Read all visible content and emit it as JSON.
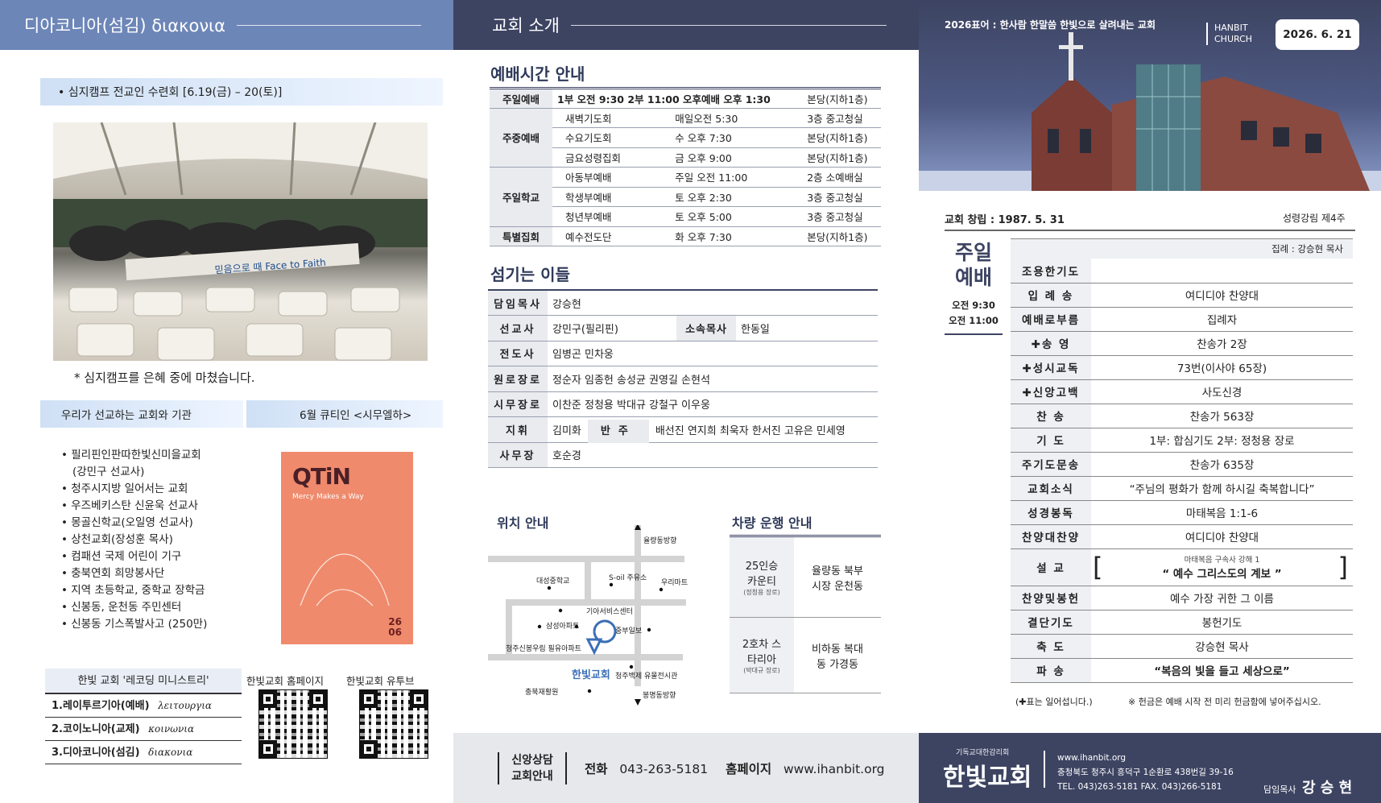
{
  "col1": {
    "header": "디아코니아(섬김) διακονια",
    "notice": "• 심지캠프 전교인 수련회 [6.19(금) – 20(토)]",
    "photo_banner": "믿음으로 때 Face to Faith",
    "photo_caption": "* 심지캠프를 은혜 중에 마쳤습니다.",
    "mission_title": "우리가 선교하는 교회와 기관",
    "qtin_title": "6월 큐티인 <시무엘하>",
    "mission_items": [
      "필리핀인판따한빛신미을교회",
      "(강민구 선교사)",
      "청주시지방 일어서는 교회",
      "우즈베키스탄 신윤욱 선교사",
      "몽골신학교(오일영 선교사)",
      "상천교회(장성훈 목사)",
      "컴패션 국제 어린이 기구",
      "충북연회 희망봉사단",
      "지역 초등학교, 중학교 장학금",
      "신봉동, 운천동 주민센터",
      "신봉동 기스폭발사고 (250만)"
    ],
    "book": {
      "logo": "QTiN",
      "subtitle": "Mercy Makes a Way",
      "issue_year": "26",
      "issue_month": "06"
    },
    "recording_title": "한빛 교회 '레코딩 미니스트리'",
    "recording_items": [
      {
        "label": "1.레이투르기아(예배)",
        "greek": "λειτουργια"
      },
      {
        "label": "2.코이노니아(교제)",
        "greek": "κοινωνια"
      },
      {
        "label": "3.디아코니아(섬김)",
        "greek": "διακονια"
      }
    ],
    "homepage_label": "한빛교회 홈페이지",
    "youtube_label": "한빛교회 유투브"
  },
  "col2": {
    "header": "교회 소개",
    "worship_title": "예배시간 안내",
    "worship_rows": [
      {
        "cat": "주일예배",
        "name": "1부 오전 9:30  2부 11:00  오후예배 오후 1:30",
        "time": "",
        "place": "본당(지하1층)"
      },
      {
        "cat": "주중예배",
        "name": "새벽기도회",
        "time": "매일오전 5:30",
        "place": "3층 중고청실"
      },
      {
        "cat": "",
        "name": "수요기도회",
        "time": "수 오후 7:30",
        "place": "본당(지하1층)"
      },
      {
        "cat": "",
        "name": "금요성령집회",
        "time": "금 오후 9:00",
        "place": "본당(지하1층)"
      },
      {
        "cat": "주일학교",
        "name": "아동부예배",
        "time": "주일 오전 11:00",
        "place": "2층 소예배실"
      },
      {
        "cat": "",
        "name": "학생부예배",
        "time": "토 오후 2:30",
        "place": "3층 중고청실"
      },
      {
        "cat": "",
        "name": "청년부예배",
        "time": "토 오후 5:00",
        "place": "3층 중고청실"
      },
      {
        "cat": "특별집회",
        "name": "예수전도단",
        "time": "화 오후 7:30",
        "place": "본당(지하1층)"
      }
    ],
    "staff_title": "섬기는 이들",
    "staff": {
      "pastor_k": "담임목사",
      "pastor_v": "강승현",
      "missionary_k": "선교사",
      "missionary_v": "강민구(필리핀)",
      "assoc_k": "소속목사",
      "assoc_v": "한동일",
      "evangelist_k": "전도사",
      "evangelist_v": "임병곤 민차웅",
      "elder_emer_k": "원로장로",
      "elder_emer_v": "정순자 임종헌 송성균 권영길 손현석",
      "elder_k": "시무장로",
      "elder_v": "이찬준 정청용 박대규 강철구 이우웅",
      "conductor_k": "지휘",
      "conductor_v": "김미화",
      "accomp_k": "반주",
      "accomp_v": "배선진 연지희 최욱자 한서진 고유은 민세영",
      "office_k": "사무장",
      "office_v": "호순경"
    },
    "location_title": "위치 안내",
    "map_labels": {
      "n1": "율량동방향",
      "n2": "대성중학교",
      "n3": "S-oil 주유소",
      "n4": "우리마트",
      "n5": "기아서비스센터",
      "n6": "삼성아파트",
      "n7": "중부일보",
      "n8": "청주신봉우림 필유아파트",
      "n9": "한빛교회",
      "n10": "청주백제 유물전시관",
      "n11": "충북재활원",
      "n12": "봉명동방향"
    },
    "bus_title": "차량 운행 안내",
    "bus": [
      {
        "car": "25인승 카운티",
        "driver": "(정청용 장로)",
        "route": "율량동 북부시장 운천동"
      },
      {
        "car": "2호차 스타리아",
        "driver": "(박대규 장로)",
        "route": "비하동 복대동 가경동"
      }
    ],
    "footer": {
      "label": "신앙상담 교회안내",
      "tel_k": "전화",
      "tel_v": "043-263-5181",
      "web_k": "홈페이지",
      "web_v": "www.ihanbit.org"
    }
  },
  "col3": {
    "slogan": "2026표어 : 한사람 한말씀 한빛으로 살려내는 교회",
    "church_en": "HANBIT CHURCH",
    "date": "2026. 6. 21",
    "founded": "교회 창립 : 1987. 5. 31",
    "season": "성령강림 제4주",
    "worship_label": "주일 예배",
    "worship_times": [
      "오전 9:30",
      "오전 11:00"
    ],
    "leader": "집례 : 강승현 목사",
    "order": [
      {
        "k": "조용한기도",
        "v": ""
      },
      {
        "k": "입 례 송",
        "v": "여디디야 찬양대"
      },
      {
        "k": "예배로부름",
        "v": "집례자"
      },
      {
        "k": "✚송   영",
        "v": "찬송가 2장"
      },
      {
        "k": "✚성시교독",
        "v": "73번(이사야 65장)"
      },
      {
        "k": "✚신앙고백",
        "v": "사도신경"
      },
      {
        "k": "찬   송",
        "v": "찬송가 563장"
      },
      {
        "k": "기   도",
        "v": "1부: 합심기도 2부: 정청용 장로"
      },
      {
        "k": "주기도문송",
        "v": "찬송가 635장"
      },
      {
        "k": "교회소식",
        "v": "“주님의 평화가 함께 하시길 축복합니다”"
      },
      {
        "k": "성경봉독",
        "v": "마태복음 1:1-6"
      },
      {
        "k": "찬양대찬양",
        "v": "여디디야 찬양대"
      },
      {
        "k": "설   교",
        "v": ""
      },
      {
        "k": "찬양및봉헌",
        "v": "예수 가장 귀한 그 이름"
      },
      {
        "k": "결단기도",
        "v": "봉헌기도"
      },
      {
        "k": "축   도",
        "v": "강승현 목사"
      },
      {
        "k": "파   송",
        "v": "“복음의 빛을 들고 세상으로”"
      }
    ],
    "sermon_ref": "마태복음 구속사 강해 1",
    "sermon_title": "“ 예수 그리스도의 계보 ”",
    "note1": "(✚표는 일어섭니다.)",
    "note2": "※ 헌금은 예배 시작 전 미리 헌금함에 넣어주십시오.",
    "footer": {
      "denom": "기독교대한감리회",
      "name": "한빛교회",
      "web": "www.ihanbit.org",
      "addr": "충청북도 청주시 흥덕구 1순환로 438번길 39-16",
      "tel": "TEL. 043)263-5181    FAX. 043)266-5181",
      "pastor_k": "담임목사",
      "pastor_v": "강 승 현"
    }
  },
  "colors": {
    "navy": "#3d4462",
    "blue": "#6d86b8",
    "orange": "#ef8a6c"
  }
}
